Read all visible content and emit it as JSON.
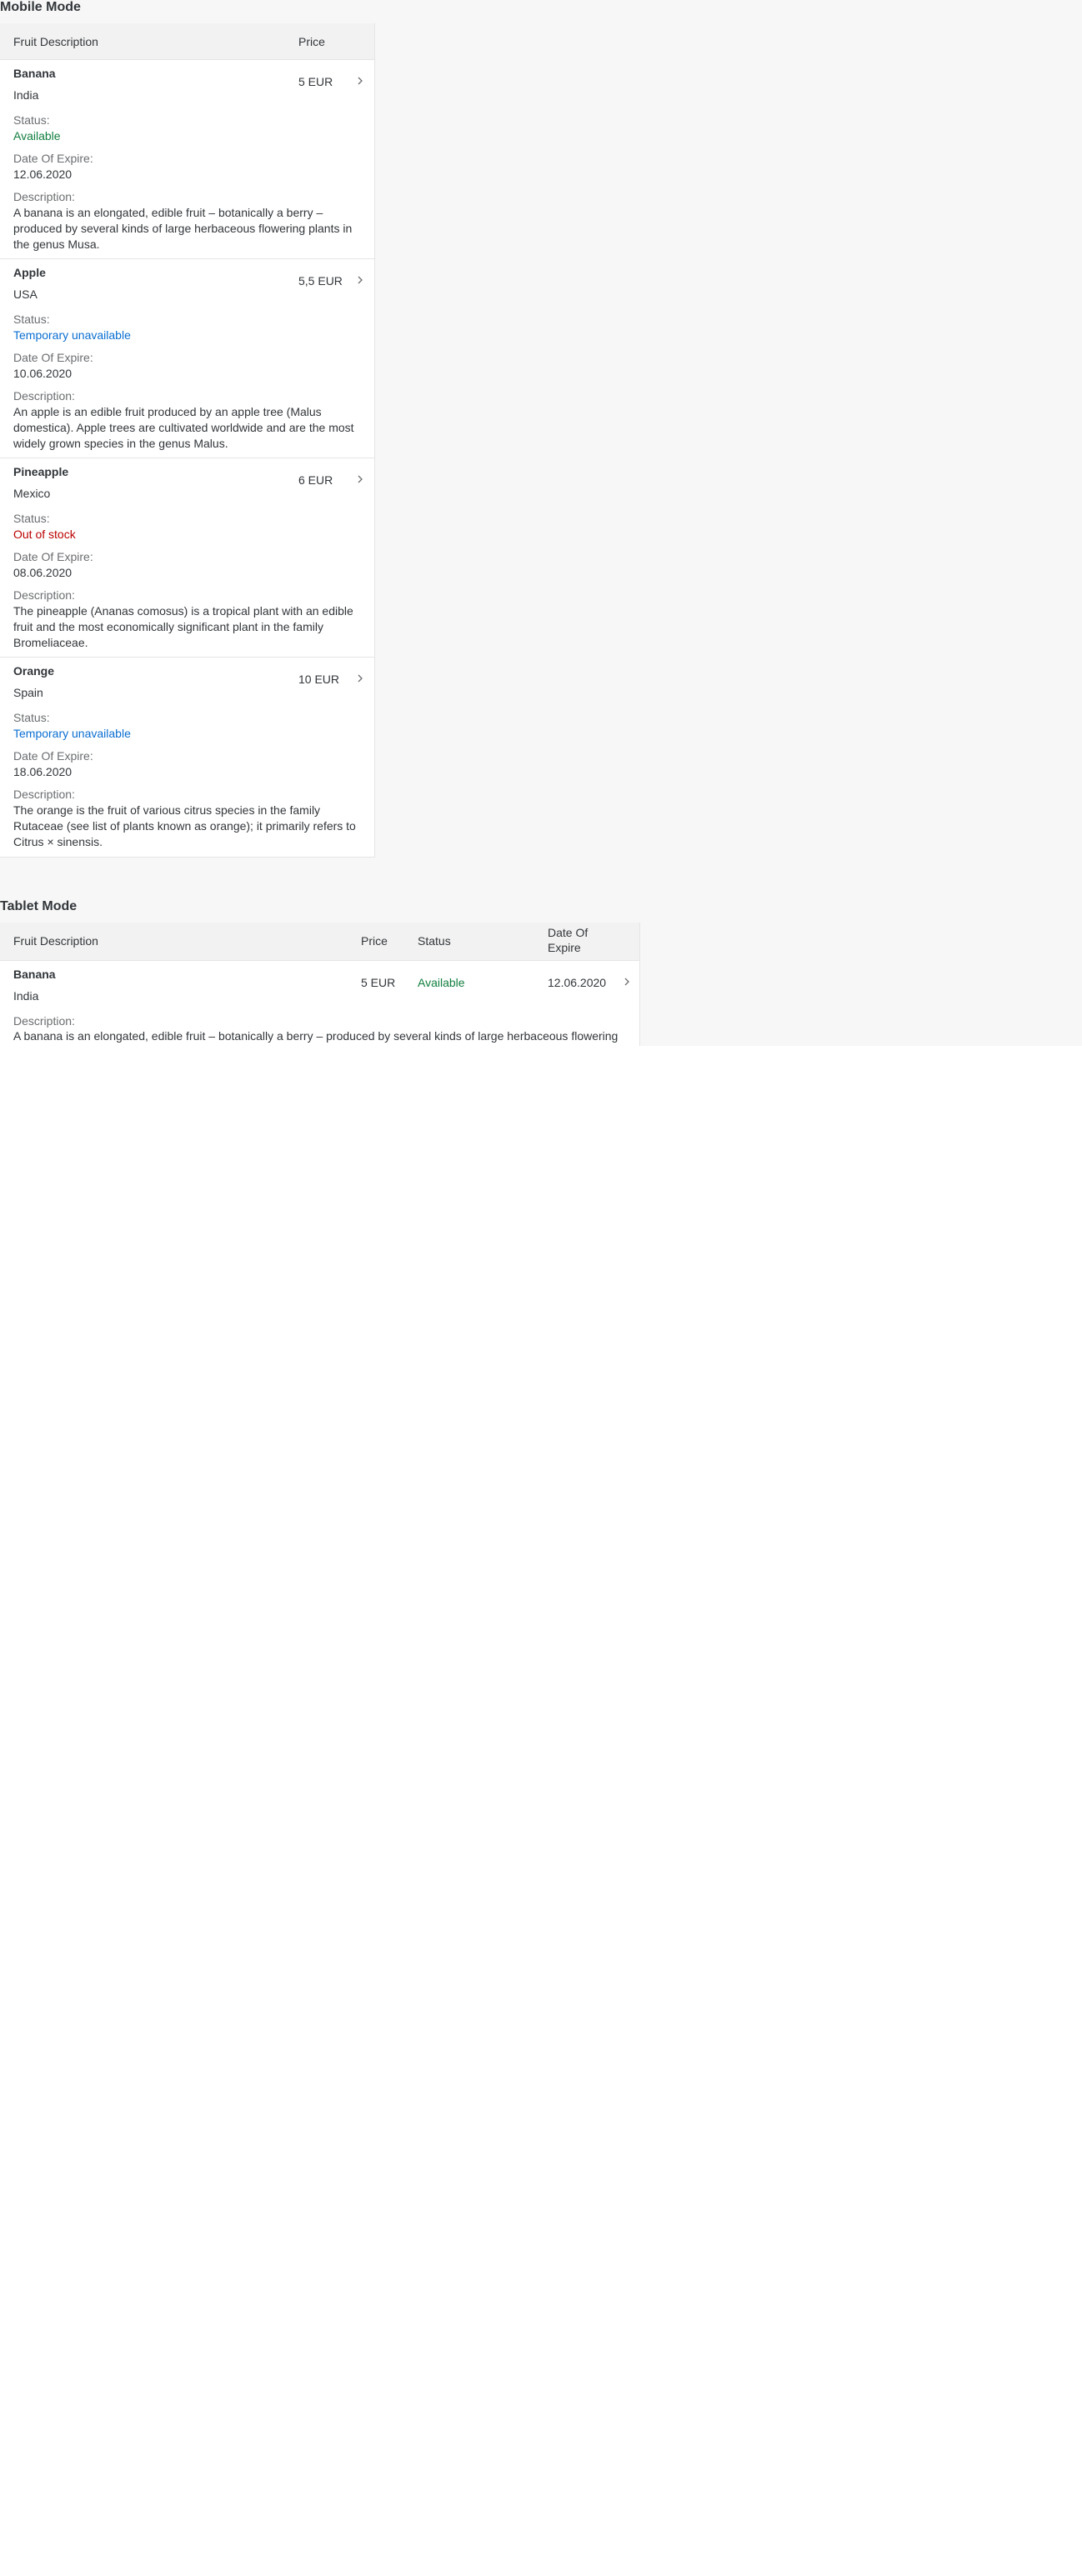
{
  "mobile": {
    "title": "Mobile Mode",
    "headers": {
      "description": "Fruit Description",
      "price": "Price"
    },
    "labels": {
      "status": "Status:",
      "expire": "Date Of Expire:",
      "description": "Description:"
    },
    "rows": [
      {
        "name": "Banana",
        "country": "India",
        "price": "5 EUR",
        "status": "Available",
        "status_state": "good",
        "expire": "12.06.2020",
        "description_lines": [
          "A banana is an elongated, edible fruit – botanically a berry –",
          "produced by several kinds of large herbaceous flowering plants in",
          "the genus Musa."
        ]
      },
      {
        "name": "Apple",
        "country": "USA",
        "price": "5,5 EUR",
        "status": "Temporary unavailable",
        "status_state": "info",
        "expire": "10.06.2020",
        "description_lines": [
          "An apple is an edible fruit produced by an apple tree (Malus",
          "domestica). Apple trees are cultivated worldwide and are the most",
          "widely grown species in the genus Malus."
        ]
      },
      {
        "name": "Pineapple",
        "country": "Mexico",
        "price": "6 EUR",
        "status": "Out of stock",
        "status_state": "bad",
        "expire": "08.06.2020",
        "description_lines": [
          "The pineapple (Ananas comosus) is a tropical plant with an edible",
          "fruit and the most economically significant plant in the family",
          "Bromeliaceae."
        ]
      },
      {
        "name": "Orange",
        "country": "Spain",
        "price": "10 EUR",
        "status": "Temporary unavailable",
        "status_state": "info",
        "expire": "18.06.2020",
        "description_lines": [
          "The orange is the fruit of various citrus species in the family",
          "Rutaceae (see list of plants known as orange); it primarily refers to",
          "Citrus × sinensis."
        ]
      }
    ]
  },
  "tablet": {
    "title": "Tablet Mode",
    "headers": {
      "description": "Fruit Description",
      "price": "Price",
      "status": "Status",
      "expire_line1": "Date Of",
      "expire_line2": "Expire"
    },
    "labels": {
      "description": "Description:"
    },
    "row": {
      "name": "Banana",
      "country": "India",
      "price": "5 EUR",
      "status": "Available",
      "status_state": "good",
      "expire": "12.06.2020",
      "description_line": "A banana is an elongated, edible fruit – botanically a berry – produced by several kinds of large herbaceous flowering"
    }
  },
  "colors": {
    "good": "#107e3e",
    "info": "#0a6ed1",
    "bad": "#bb0000",
    "header_bg": "#f2f2f2",
    "page_bg": "#f7f7f7"
  },
  "icons": {
    "row_navigation": "chevron-right-icon"
  }
}
